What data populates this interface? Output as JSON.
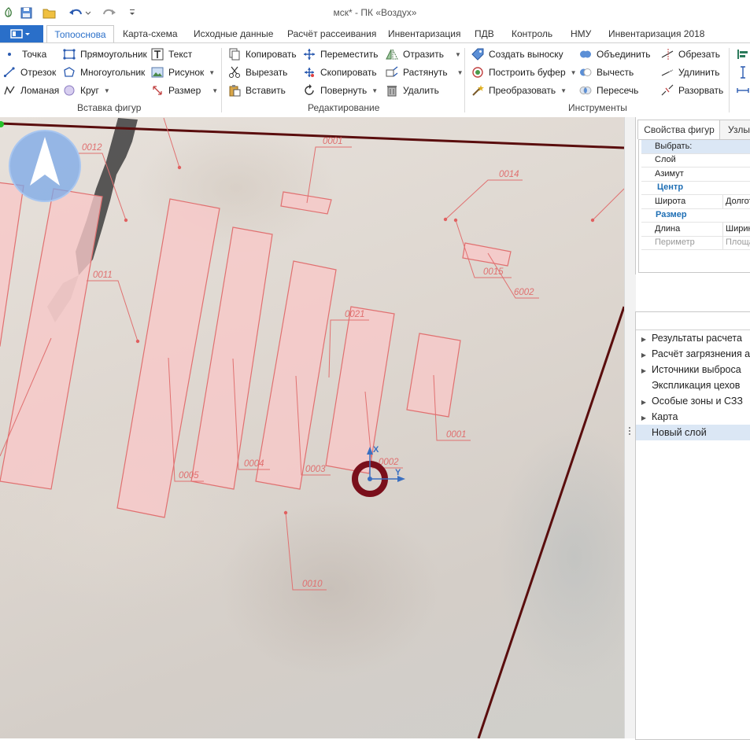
{
  "window": {
    "title": "мск* - ПК «Воздух»"
  },
  "tabs": [
    {
      "label": "Топооснова"
    },
    {
      "label": "Карта-схема"
    },
    {
      "label": "Исходные данные"
    },
    {
      "label": "Расчёт рассеивания"
    },
    {
      "label": "Инвентаризация"
    },
    {
      "label": "ПДВ"
    },
    {
      "label": "Контроль"
    },
    {
      "label": "НМУ"
    },
    {
      "label": "Инвентаризация 2018"
    }
  ],
  "ribbon": {
    "insert": {
      "label": "Вставка фигур",
      "point": "Точка",
      "segment": "Отрезок",
      "polyline": "Ломаная",
      "rectangle": "Прямоугольник",
      "polygon": "Многоугольник",
      "circle": "Круг",
      "text": "Текст",
      "picture": "Рисунок",
      "dimension": "Размер"
    },
    "edit": {
      "label": "Редактирование",
      "copy": "Копировать",
      "cut": "Вырезать",
      "paste": "Вставить",
      "move": "Переместить",
      "copy2": "Скопировать",
      "rotate": "Повернуть",
      "mirror": "Отразить",
      "stretch": "Растянуть",
      "delete": "Удалить"
    },
    "tools": {
      "label": "Инструменты",
      "callout": "Создать выноску",
      "buffer": "Построить буфер",
      "transform": "Преобразовать",
      "union": "Объединить",
      "subtract": "Вычесть",
      "intersect": "Пересечь",
      "trim": "Обрезать",
      "extend": "Удлинить",
      "split": "Разорвать"
    }
  },
  "map": {
    "labels": {
      "l0012": "0012",
      "l0011": "0011",
      "l0001top": "0001",
      "l0014": "0014",
      "l0015": "0015",
      "l6002": "6002",
      "l0021": "0021",
      "l0001": "0001",
      "l0002": "0002",
      "l0003": "0003",
      "l0004": "0004",
      "l0005": "0005",
      "l0010": "0010"
    },
    "axis_x": "X",
    "axis_y": "Y"
  },
  "properties_panel": {
    "tabs": [
      {
        "label": "Свойства фигур"
      },
      {
        "label": "Узлы"
      }
    ],
    "rows": {
      "select": "Выбрать:",
      "layer": "Слой",
      "azimuth": "Азимут",
      "center_header": "Центр",
      "latitude": "Широта",
      "longitude": "Долгота",
      "size_header": "Размер",
      "length": "Длина",
      "width": "Ширина",
      "perimeter": "Периметр",
      "area": "Площадь"
    }
  },
  "layers_panel": {
    "items": [
      {
        "label": "Результаты расчета",
        "expandable": true
      },
      {
        "label": "Расчёт загрязнения атмосферы",
        "expandable": true
      },
      {
        "label": "Источники выброса",
        "expandable": true
      },
      {
        "label": "Экспликация цехов",
        "expandable": false
      },
      {
        "label": "Особые зоны и СЗЗ",
        "expandable": true
      },
      {
        "label": "Карта",
        "expandable": true
      },
      {
        "label": "Новый слой",
        "expandable": false
      }
    ]
  },
  "colors": {
    "accent": "#2a6fc9",
    "shape_fill": "#f7c8c8",
    "shape_stroke": "#e07070",
    "boundary": "#5a0d0d",
    "selection_marker": "#7a0f1b",
    "group_header_text": "#1f6fb5"
  }
}
